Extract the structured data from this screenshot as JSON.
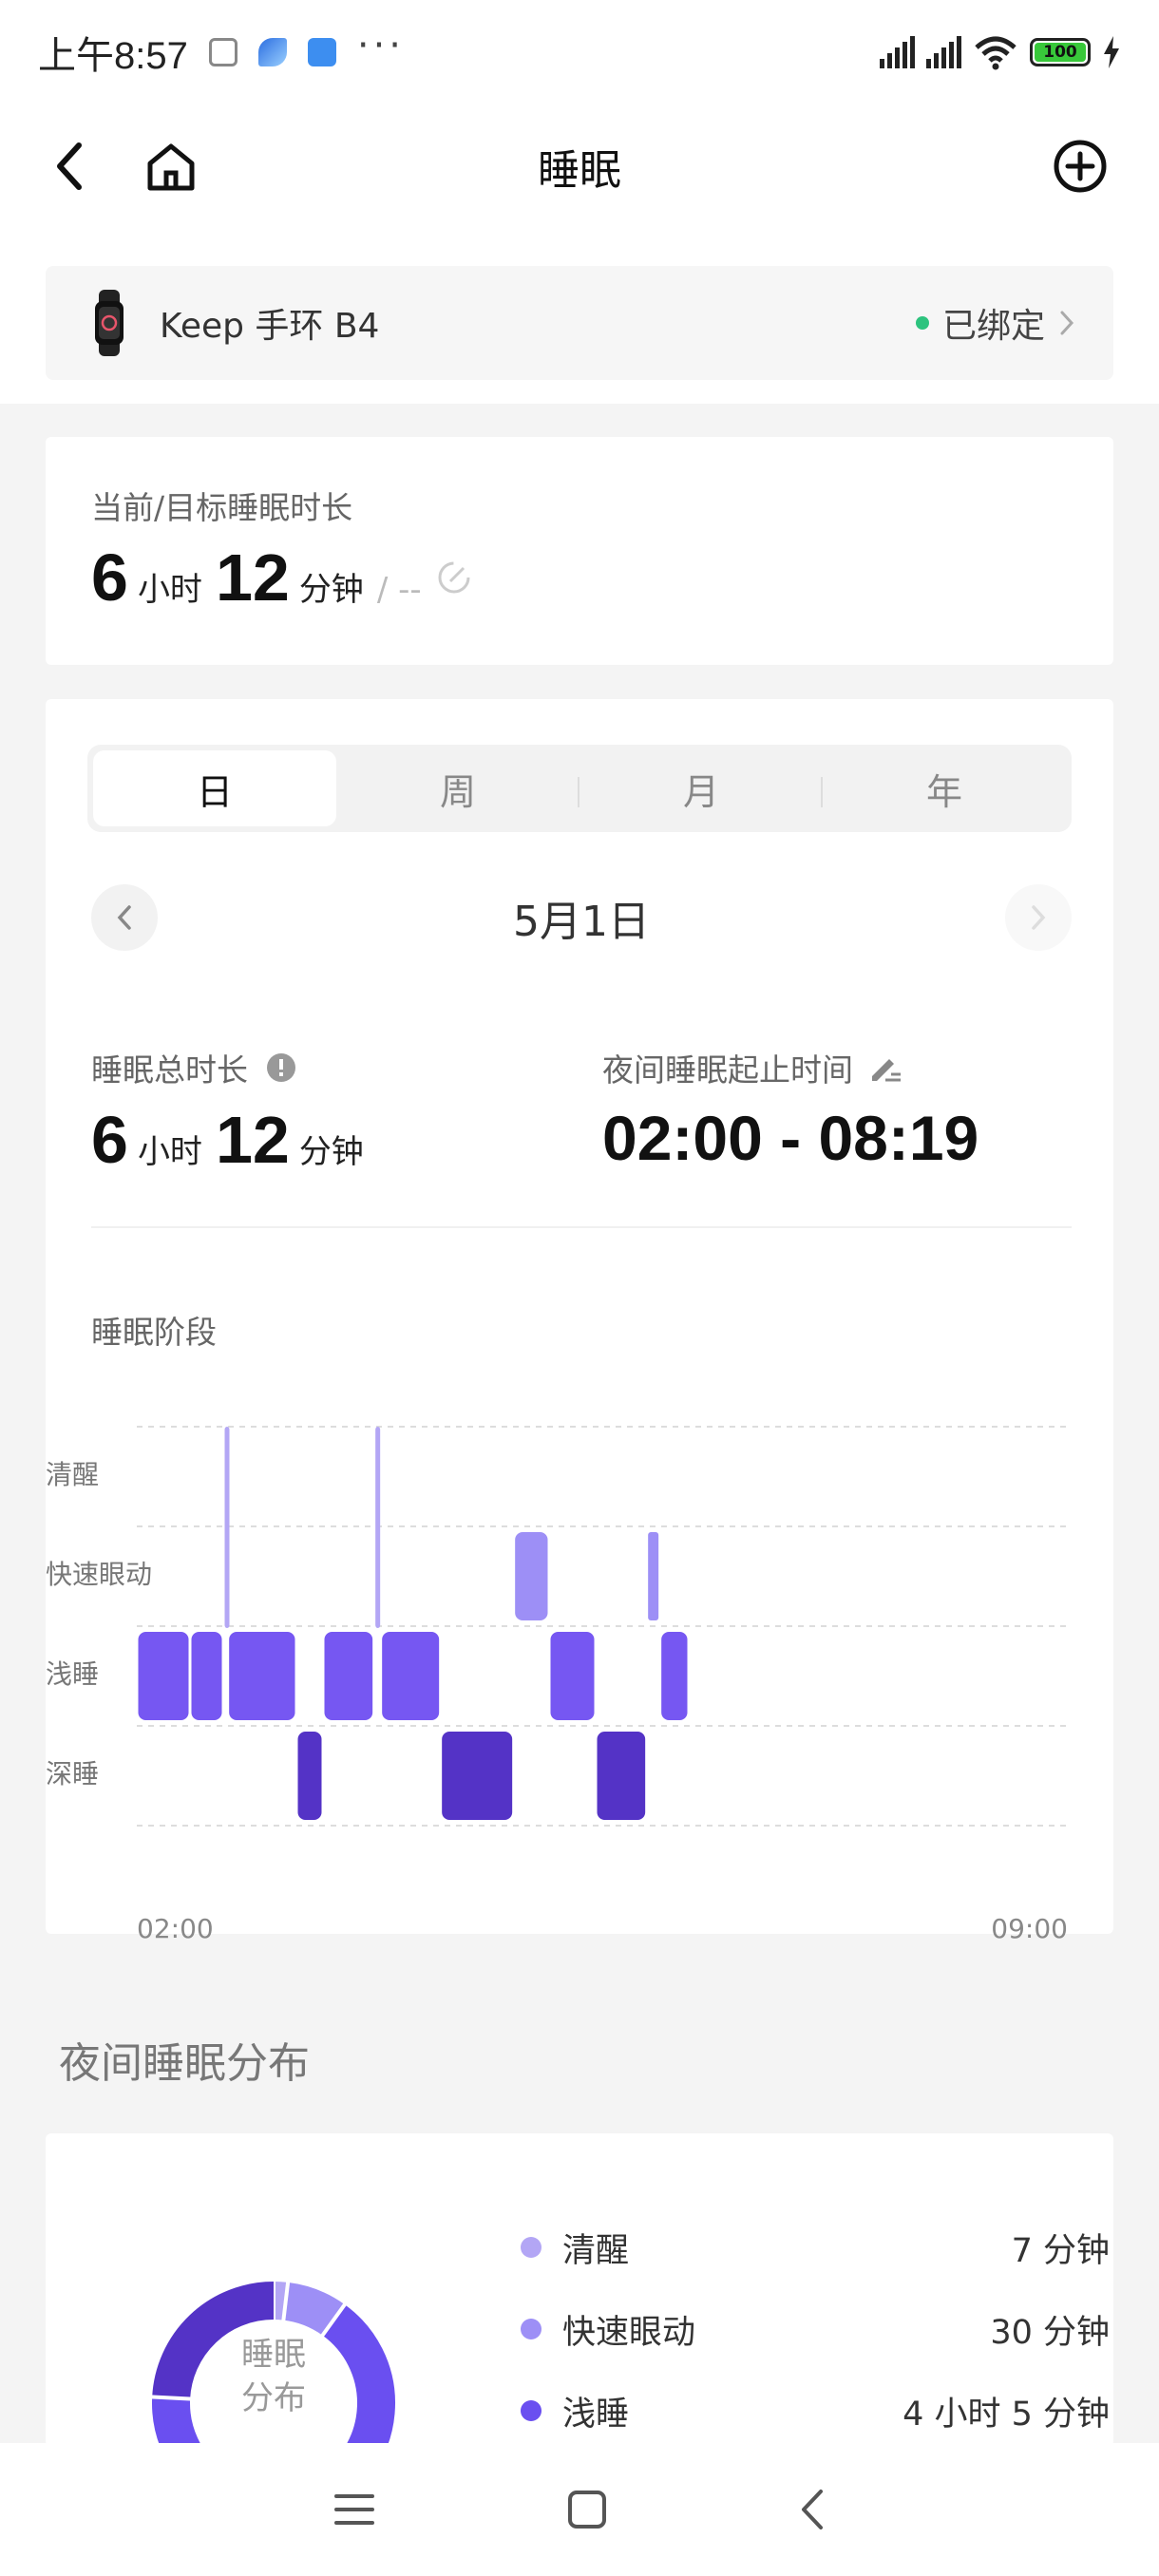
{
  "status_bar": {
    "time": "上午8:57",
    "more": "···",
    "battery": "100"
  },
  "header": {
    "title": "睡眠"
  },
  "device": {
    "name": "Keep 手环 B4",
    "status": "已绑定"
  },
  "current_card": {
    "label": "当前/目标睡眠时长",
    "hours": "6",
    "hours_unit": "小时",
    "minutes": "12",
    "minutes_unit": "分钟",
    "goal": "/ --"
  },
  "tabs": [
    "日",
    "周",
    "月",
    "年"
  ],
  "date": "5月1日",
  "summary": {
    "total_label": "睡眠总时长",
    "hours": "6",
    "hours_unit": "小时",
    "minutes": "12",
    "minutes_unit": "分钟",
    "range_label": "夜间睡眠起止时间",
    "range": "02:00 - 08:19"
  },
  "stages_title": "睡眠阶段",
  "chart_data": {
    "type": "sleep-stage",
    "x_start": "02:00",
    "x_end": "09:00",
    "x_tick_labels": [
      "02:00",
      "09:00"
    ],
    "y_categories": [
      "清醒",
      "快速眼动",
      "浅睡",
      "深睡"
    ],
    "colors": {
      "清醒": "#b3a6f5",
      "快速眼动": "#9d8ff6",
      "浅睡": "#7657f2",
      "深睡": "#5433c6"
    },
    "segments": [
      {
        "stage": "浅睡",
        "start": "02:00",
        "end": "02:24"
      },
      {
        "stage": "浅睡",
        "start": "02:24",
        "end": "02:39"
      },
      {
        "stage": "清醒",
        "start": "02:39",
        "end": "02:41"
      },
      {
        "stage": "浅睡",
        "start": "02:41",
        "end": "03:12"
      },
      {
        "stage": "深睡",
        "start": "03:12",
        "end": "03:24"
      },
      {
        "stage": "浅睡",
        "start": "03:24",
        "end": "03:47"
      },
      {
        "stage": "清醒",
        "start": "03:47",
        "end": "03:50"
      },
      {
        "stage": "浅睡",
        "start": "03:50",
        "end": "04:17"
      },
      {
        "stage": "深睡",
        "start": "04:17",
        "end": "04:50"
      },
      {
        "stage": "快速眼动",
        "start": "04:50",
        "end": "05:06"
      },
      {
        "stage": "浅睡",
        "start": "05:06",
        "end": "05:27"
      },
      {
        "stage": "深睡",
        "start": "05:27",
        "end": "05:50"
      },
      {
        "stage": "快速眼动",
        "start": "05:50",
        "end": "05:56"
      },
      {
        "stage": "浅睡",
        "start": "05:56",
        "end": "06:09"
      }
    ]
  },
  "distribution": {
    "title": "夜间睡眠分布",
    "donut_label_line1": "睡眠",
    "donut_label_line2": "分布",
    "items": [
      {
        "name": "清醒",
        "value": "7 分钟",
        "minutes": 7,
        "color": "#b3a6f5"
      },
      {
        "name": "快速眼动",
        "value": "30 分钟",
        "minutes": 30,
        "color": "#9d8ff6"
      },
      {
        "name": "浅睡",
        "value": "4 小时 5 分钟",
        "minutes": 245,
        "color": "#6a4ff0"
      }
    ],
    "deep_minutes": 90,
    "deep_color": "#5433c6"
  }
}
